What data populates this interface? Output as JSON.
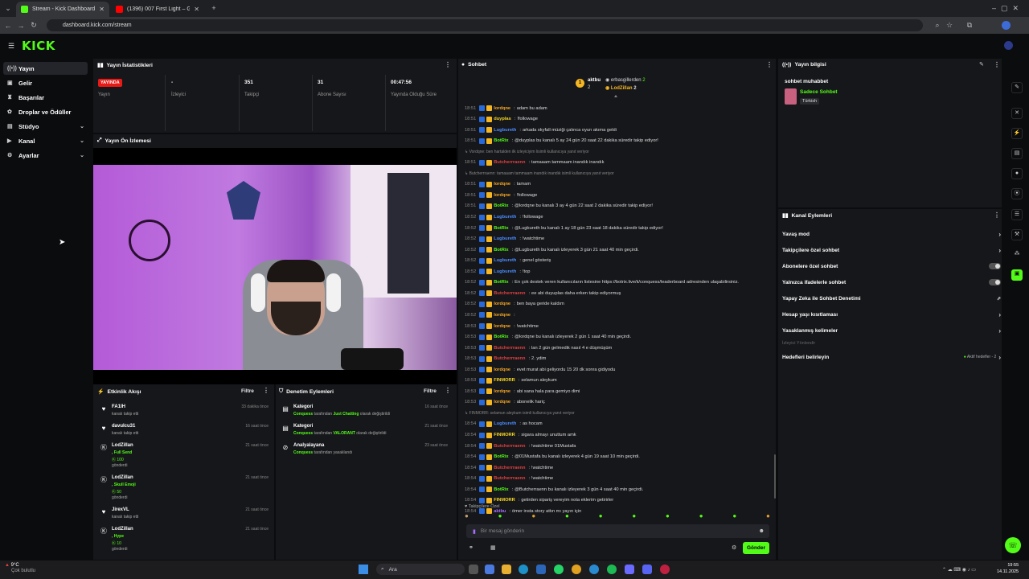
{
  "browser": {
    "tabs": [
      {
        "label": "Stream - Kick Dashboard"
      },
      {
        "label": "(1396) 007 First Light – Gamepl"
      }
    ],
    "url": "dashboard.kick.com/stream"
  },
  "brand": {
    "logo": "KICK",
    "accent": "#53fc18"
  },
  "sidebar": {
    "items": [
      {
        "label": "Yayın"
      },
      {
        "label": "Gelir"
      },
      {
        "label": "Başarılar"
      },
      {
        "label": "Droplar ve Ödüller"
      },
      {
        "label": "Stüdyo"
      },
      {
        "label": "Kanal"
      },
      {
        "label": "Ayarlar"
      }
    ]
  },
  "stats": {
    "title": "Yayın İstatistikleri",
    "live_badge": "YAYINDA",
    "cols": [
      {
        "value": "",
        "label": "Yayın"
      },
      {
        "value": "-",
        "label": "İzleyici"
      },
      {
        "value": "351",
        "label": "Takipçi"
      },
      {
        "value": "31",
        "label": "Abone Sayısı"
      },
      {
        "value": "00:47:56",
        "label": "Yayında Olduğu Süre"
      }
    ]
  },
  "preview": {
    "title": "Yayın Ön İzlemesi"
  },
  "feed": {
    "title": "Etkinlik Akışı",
    "filter": "Filtre",
    "rows": [
      {
        "name": "FA1IH",
        "sub": "kanalı takip etti",
        "time": "33 dakika önce",
        "extra": "",
        "count": ""
      },
      {
        "name": "davulcu31",
        "sub": "kanalı takip etti",
        "time": "16 saat önce",
        "extra": "",
        "count": ""
      },
      {
        "name": "LodZillan",
        "sub": "gönderdi",
        "time": "21 saat önce",
        "extra": ", Full Send",
        "count": "100"
      },
      {
        "name": "LodZillan",
        "sub": "gönderdi",
        "time": "21 saat önce",
        "extra": ", Skull Emoji",
        "count": "50"
      },
      {
        "name": "JirexVL",
        "sub": "kanalı takip etti",
        "time": "21 saat önce",
        "extra": "",
        "count": ""
      },
      {
        "name": "LodZillan",
        "sub": "gönderdi",
        "time": "21 saat önce",
        "extra": ", Hype",
        "count": "10"
      }
    ]
  },
  "mod": {
    "title": "Denetim Eylemleri",
    "filter": "Filtre",
    "rows": [
      {
        "title": "Kategori",
        "actor": "Conquess",
        "text": " tarafından ",
        "target": "Just Chatting",
        "tail": " olarak değiştirildi",
        "time": "16 saat önce"
      },
      {
        "title": "Kategori",
        "actor": "Conquess",
        "text": " tarafından ",
        "target": "VALORANT",
        "tail": " olarak değiştirildi",
        "time": "21 saat önce"
      },
      {
        "title": "Analyalayana",
        "actor": "Conquess",
        "text": " tarafından yasaklandı",
        "target": "",
        "tail": "",
        "time": "23 saat önce"
      }
    ]
  },
  "chat": {
    "title": "Sohbet",
    "top": [
      {
        "rank": "1",
        "name": "aktbu"
      },
      {
        "rank": "",
        "name": "erbasgillerden",
        "count": "2"
      },
      {
        "rank": "2",
        "name": "LodZillan",
        "count": "2"
      }
    ],
    "lines": [
      {
        "t": "18:51",
        "u": "lordqne",
        "c": "#f5a623",
        "m": "adam bu adam"
      },
      {
        "t": "18:51",
        "u": "duyplas",
        "c": "#f5d623",
        "m": "!followage"
      },
      {
        "t": "18:51",
        "u": "Lugbureth",
        "c": "#4a8cff",
        "m": "arkada skyfall müziği çalınca oyun akıma geldi"
      },
      {
        "t": "18:51",
        "u": "BotRix",
        "c": "#53fc18",
        "m": "@duyplas bu kanalı 5 ay 24 gün 20 saat 22 dakika süredir takip ediyor!"
      },
      {
        "sys": "↳ Vordqne: ben hartalden ilk izleyiciyim lisimli kullanıcıya yanıt veriyor"
      },
      {
        "t": "18:51",
        "u": "Butcherrraenn",
        "c": "#e04040",
        "m": "tamaaam tammaam inandık inandık"
      },
      {
        "sys": "↳ Butcherrraenn: tamaaam tammaam inandık inandık isimli kullanıcıya yanıt veriyor"
      },
      {
        "t": "18:51",
        "u": "lordqne",
        "c": "#f5a623",
        "m": "tamam"
      },
      {
        "t": "18:51",
        "u": "lordqne",
        "c": "#f5a623",
        "m": "!followage"
      },
      {
        "t": "18:51",
        "u": "BotRix",
        "c": "#53fc18",
        "m": "@lordqne bu kanalı 3 ay 4 gün 22 saat 2 dakika süredir takip ediyor!"
      },
      {
        "t": "18:52",
        "u": "Lugbureth",
        "c": "#4a8cff",
        "m": "!followage"
      },
      {
        "t": "18:52",
        "u": "BotRix",
        "c": "#53fc18",
        "m": "@Lugbureth bu kanalı 1 ay 18 gün 23 saat 18 dakika süredir takip ediyor!"
      },
      {
        "t": "18:52",
        "u": "Lugbureth",
        "c": "#4a8cff",
        "m": "!watchtime"
      },
      {
        "t": "18:52",
        "u": "BotRix",
        "c": "#53fc18",
        "m": "@Lugbureth bu kanalı izleyerek 3 gün 21 saat 40 min geçirdi."
      },
      {
        "t": "18:52",
        "u": "Lugbureth",
        "c": "#4a8cff",
        "m": "genel gösteriş"
      },
      {
        "t": "18:52",
        "u": "Lugbureth",
        "c": "#4a8cff",
        "m": "!top"
      },
      {
        "t": "18:52",
        "u": "BotRix",
        "c": "#53fc18",
        "m": "En çok destek veren kullanıcıların listesine https://botrix.live/k/conquess/leaderboard adresinden ulaşabilirsiniz."
      },
      {
        "t": "18:52",
        "u": "Butcherrraenn",
        "c": "#e04040",
        "m": "ee abi duyuplas daha erken takip ediyormuş"
      },
      {
        "t": "18:52",
        "u": "lordqne",
        "c": "#f5a623",
        "m": "ben baya geride kaldım"
      },
      {
        "t": "18:52",
        "u": "lordqne",
        "c": "#f5a623",
        "m": ""
      },
      {
        "t": "18:53",
        "u": "lordqne",
        "c": "#f5a623",
        "m": "!watchtime"
      },
      {
        "t": "18:53",
        "u": "BotRix",
        "c": "#53fc18",
        "m": "@lordqne bu kanalı izleyerek 2 gün 1 saat 40 min geçirdi."
      },
      {
        "t": "18:53",
        "u": "Butcherrraenn",
        "c": "#e04040",
        "m": "lan 2 gün gelmedik nasıl 4 e düşmüşüm"
      },
      {
        "t": "18:53",
        "u": "Butcherrraenn",
        "c": "#e04040",
        "m": "2. ydim"
      },
      {
        "t": "18:53",
        "u": "lordqne",
        "c": "#f5a623",
        "m": "evet murat abi geliyordu 15 20 dk sonra gidiyodu"
      },
      {
        "t": "18:53",
        "u": "FINMORR",
        "c": "#f5d623",
        "m": "selamun aleykum"
      },
      {
        "t": "18:53",
        "u": "lordqne",
        "c": "#f5a623",
        "m": "abi sana hala para gemiyo dimi"
      },
      {
        "t": "18:53",
        "u": "lordqne",
        "c": "#f5a623",
        "m": "abonelik hariç"
      },
      {
        "sys": "↳ FINMORR: selamun aleykum isimli kullanıcıya yanıt veriyor"
      },
      {
        "t": "18:54",
        "u": "Lugbureth",
        "c": "#4a8cff",
        "m": "as hocam"
      },
      {
        "t": "18:54",
        "u": "FINMORR",
        "c": "#f5d623",
        "m": "sigara almayı unuttum amk"
      },
      {
        "t": "18:54",
        "u": "Butcherrraenn",
        "c": "#e04040",
        "m": "!watchtime 01Mustafa"
      },
      {
        "t": "18:54",
        "u": "BotRix",
        "c": "#53fc18",
        "m": "@01Mustafa bu kanalı izleyerek 4 gün 19 saat 10 min geçirdi."
      },
      {
        "t": "18:54",
        "u": "Butcherrraenn",
        "c": "#e04040",
        "m": "!watchtime"
      },
      {
        "t": "18:54",
        "u": "Butcherrraenn",
        "c": "#e04040",
        "m": "!watchtime"
      },
      {
        "t": "18:54",
        "u": "BotRix",
        "c": "#53fc18",
        "m": "@Butcherraenn bu kanalı izleyerek 3 gün 4 saat 40 min geçirdi."
      },
      {
        "t": "18:54",
        "u": "FINMORR",
        "c": "#f5d623",
        "m": "getirden sipariş vereyim nota eklerim getirirler"
      },
      {
        "t": "18:54",
        "u": "aktbu",
        "c": "#a86cff",
        "m": "ömer insta story attın mı yayın için"
      }
    ],
    "followers_only": "Takipçilere Özel",
    "input_placeholder": "Bir mesaj gönderin",
    "send": "Gönder"
  },
  "info": {
    "title": "Yayın bilgisi",
    "stream_title": "sohbet muhabbet",
    "category": "Sadece Sohbet",
    "lang": "Türkish"
  },
  "actions": {
    "title": "Kanal Eylemleri",
    "items": [
      {
        "label": "Yavaş mod",
        "kind": "arrow"
      },
      {
        "label": "Takipçilere özel sohbet",
        "kind": "arrow"
      },
      {
        "label": "Abonelere özel sohbet",
        "kind": "toggle"
      },
      {
        "label": "Yalnızca ifadelerle sohbet",
        "kind": "toggle"
      },
      {
        "label": "Yapay Zeka ile Sohbet Denetimi",
        "kind": "ext"
      },
      {
        "label": "Hesap yaşı kısıtlaması",
        "kind": "arrow"
      },
      {
        "label": "Yasaklanmış kelimeler",
        "kind": "arrow"
      }
    ],
    "section": "İzleyici Yönlendir",
    "goals": "Hedefleri belirleyin",
    "goals_status": "Aktif hedefler - 2"
  },
  "taskbar": {
    "weather_temp": "9°C",
    "weather_desc": "Çok bulutlu",
    "search": "Ara",
    "time": "19:55",
    "date": "14.11.2025"
  }
}
